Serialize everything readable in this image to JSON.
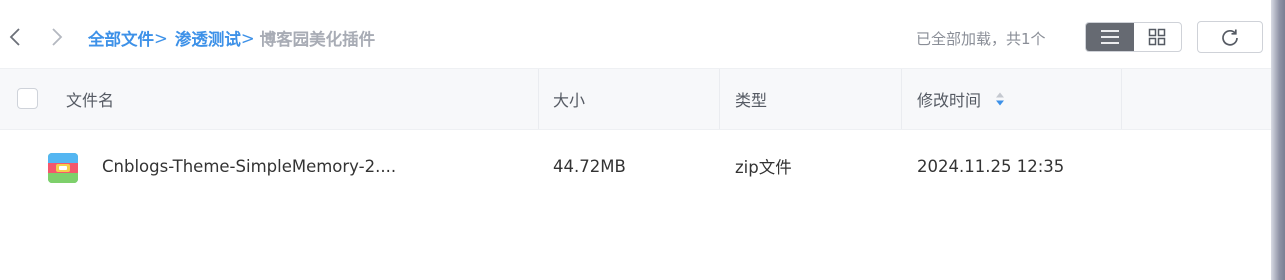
{
  "nav": {
    "back_icon": "chevron-left-icon",
    "forward_icon": "chevron-right-icon"
  },
  "breadcrumb": {
    "items": [
      "全部文件",
      "渗透测试"
    ],
    "separator": ">",
    "current": "博客园美化插件"
  },
  "status": {
    "loaded_text": "已全部加载，共1个"
  },
  "toolbar": {
    "list_view_icon": "list-view-icon",
    "grid_view_icon": "grid-view-icon",
    "refresh_icon": "refresh-icon",
    "active_view": "list"
  },
  "table": {
    "columns": [
      "文件名",
      "大小",
      "类型",
      "修改时间"
    ],
    "sort_column": "修改时间",
    "rows": [
      {
        "name": "Cnblogs-Theme-SimpleMemory-2....",
        "size": "44.72MB",
        "type": "zip文件",
        "modified": "2024.11.25 12:35",
        "icon": "zip-archive-icon"
      }
    ]
  },
  "colors": {
    "accent": "#3d91e8",
    "muted": "#a8acb5",
    "header_bg": "#f7f8fa",
    "active_toggle": "#666a72"
  }
}
